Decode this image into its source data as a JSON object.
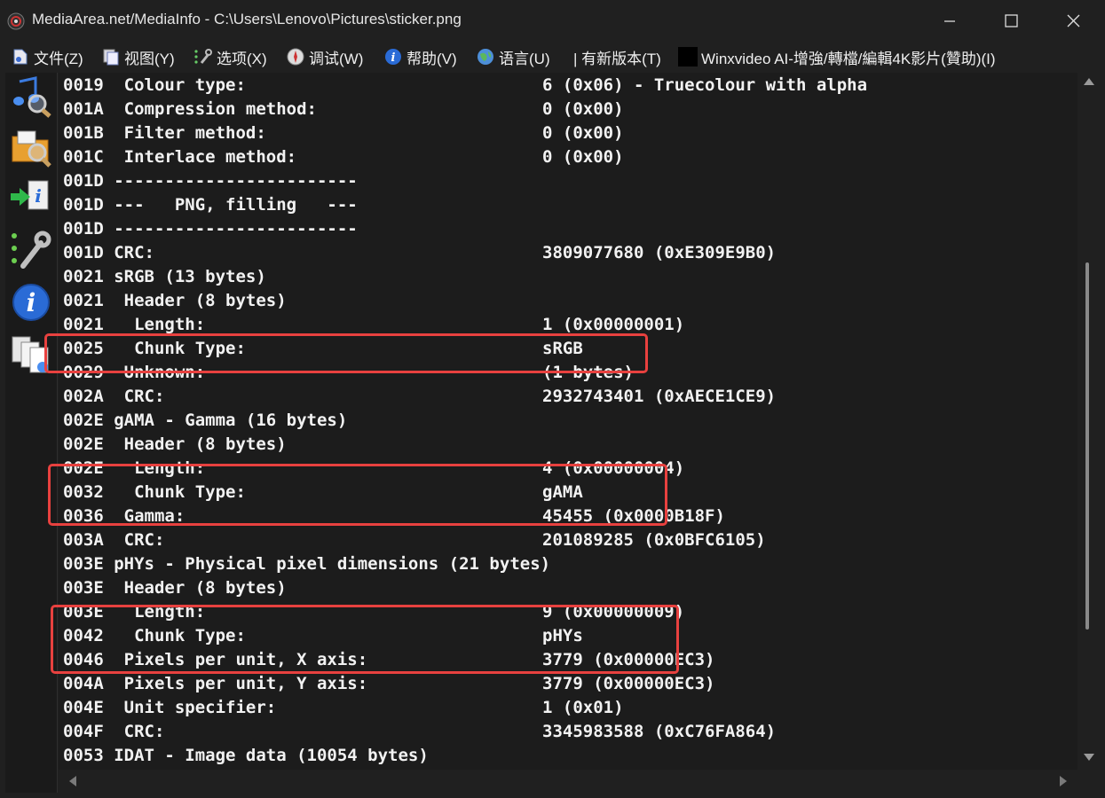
{
  "window": {
    "title": "MediaArea.net/MediaInfo - C:\\Users\\Lenovo\\Pictures\\sticker.png",
    "app_icon": "speaker-icon",
    "controls": [
      "minimize-icon",
      "maximize-icon",
      "close-icon"
    ]
  },
  "menu": {
    "items": [
      {
        "label": "文件(Z)",
        "icon": "file-icon"
      },
      {
        "label": "视图(Y)",
        "icon": "view-icon"
      },
      {
        "label": "选项(X)",
        "icon": "options-icon"
      },
      {
        "label": "调试(W)",
        "icon": "debug-icon"
      },
      {
        "label": "帮助(V)",
        "icon": "help-icon"
      },
      {
        "label": "语言(U)",
        "icon": "language-icon"
      },
      {
        "label": "| 有新版本(T)",
        "icon": ""
      },
      {
        "label": "Winxvideo AI-增強/轉檔/編輯4K影片(贊助)(I)",
        "icon": "sponsor-icon"
      }
    ]
  },
  "toolbar": {
    "tools": [
      "open-file-icon",
      "open-folder-icon",
      "export-icon",
      "preferences-icon",
      "about-icon",
      "knowledge-base-icon"
    ]
  },
  "content": {
    "lines": [
      {
        "left": "0019  Colour type:",
        "right": "6 (0x06) - Truecolour with alpha"
      },
      {
        "left": "001A  Compression method:",
        "right": "0 (0x00)"
      },
      {
        "left": "001B  Filter method:",
        "right": "0 (0x00)"
      },
      {
        "left": "001C  Interlace method:",
        "right": "0 (0x00)"
      },
      {
        "left": "001D ------------------------",
        "right": ""
      },
      {
        "left": "001D ---   PNG, filling   ---",
        "right": ""
      },
      {
        "left": "001D ------------------------",
        "right": ""
      },
      {
        "left": "001D CRC:",
        "right": "3809077680 (0xE309E9B0)"
      },
      {
        "left": "0021 sRGB (13 bytes)",
        "right": ""
      },
      {
        "left": "0021  Header (8 bytes)",
        "right": ""
      },
      {
        "left": "0021   Length:",
        "right": "1 (0x00000001)"
      },
      {
        "left": "0025   Chunk Type:",
        "right": "sRGB"
      },
      {
        "left": "0029  Unknown:",
        "right": "(1 bytes)"
      },
      {
        "left": "002A  CRC:",
        "right": "2932743401 (0xAECE1CE9)"
      },
      {
        "left": "002E gAMA - Gamma (16 bytes)",
        "right": ""
      },
      {
        "left": "002E  Header (8 bytes)",
        "right": ""
      },
      {
        "left": "002E   Length:",
        "right": "4 (0x00000004)"
      },
      {
        "left": "0032   Chunk Type:",
        "right": "gAMA"
      },
      {
        "left": "0036  Gamma:",
        "right": "45455 (0x0000B18F)"
      },
      {
        "left": "003A  CRC:",
        "right": "201089285 (0x0BFC6105)"
      },
      {
        "left": "003E pHYs - Physical pixel dimensions (21 bytes)",
        "right": ""
      },
      {
        "left": "003E  Header (8 bytes)",
        "right": ""
      },
      {
        "left": "003E   Length:",
        "right": "9 (0x00000009)"
      },
      {
        "left": "0042   Chunk Type:",
        "right": "pHYs"
      },
      {
        "left": "0046  Pixels per unit, X axis:",
        "right": "3779 (0x00000EC3)"
      },
      {
        "left": "004A  Pixels per unit, Y axis:",
        "right": "3779 (0x00000EC3)"
      },
      {
        "left": "004E  Unit specifier:",
        "right": "1 (0x01)"
      },
      {
        "left": "004F  CRC:",
        "right": "3345983588 (0xC76FA864)"
      },
      {
        "left": "0053 IDAT - Image data (10054 bytes)",
        "right": ""
      }
    ]
  },
  "colors": {
    "background": "#1c1c1c",
    "text": "#f2f2f2",
    "highlight": "#e8413f"
  }
}
